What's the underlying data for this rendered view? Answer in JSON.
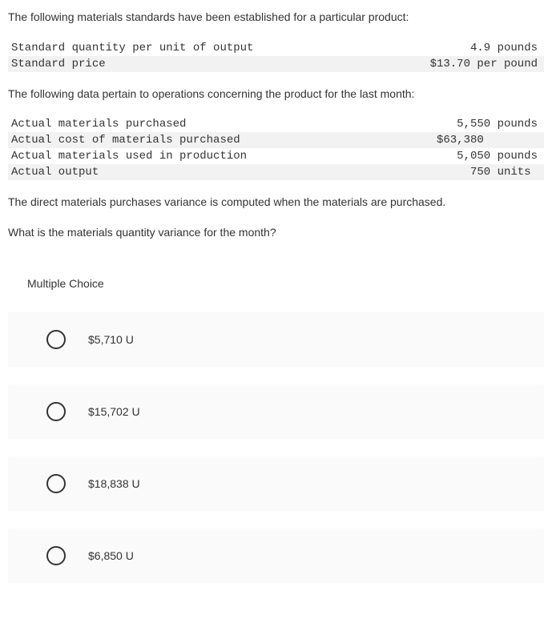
{
  "intro_text": "The following materials standards have been established for a particular product:",
  "standards_table": [
    {
      "label": "Standard quantity per unit of output",
      "value": "4.9 pounds",
      "shaded": false
    },
    {
      "label": "Standard price",
      "value": "$13.70 per pound",
      "shaded": true
    }
  ],
  "data_intro": "The following data pertain to operations concerning the product for the last month:",
  "actuals_table": [
    {
      "label": "Actual materials purchased",
      "value": "5,550 pounds",
      "shaded": false
    },
    {
      "label": "Actual cost of materials purchased",
      "value": "$63,380        ",
      "shaded": true
    },
    {
      "label": "Actual materials used in production",
      "value": "5,050 pounds",
      "shaded": false
    },
    {
      "label": "Actual output",
      "value": "750 units ",
      "shaded": true
    }
  ],
  "note_text": "The direct materials purchases variance is computed when the materials are purchased.",
  "question_text": "What is the materials quantity variance for the month?",
  "mc_label": "Multiple Choice",
  "options": [
    {
      "label": "$5,710 U"
    },
    {
      "label": "$15,702 U"
    },
    {
      "label": "$18,838 U"
    },
    {
      "label": "$6,850 U"
    }
  ]
}
